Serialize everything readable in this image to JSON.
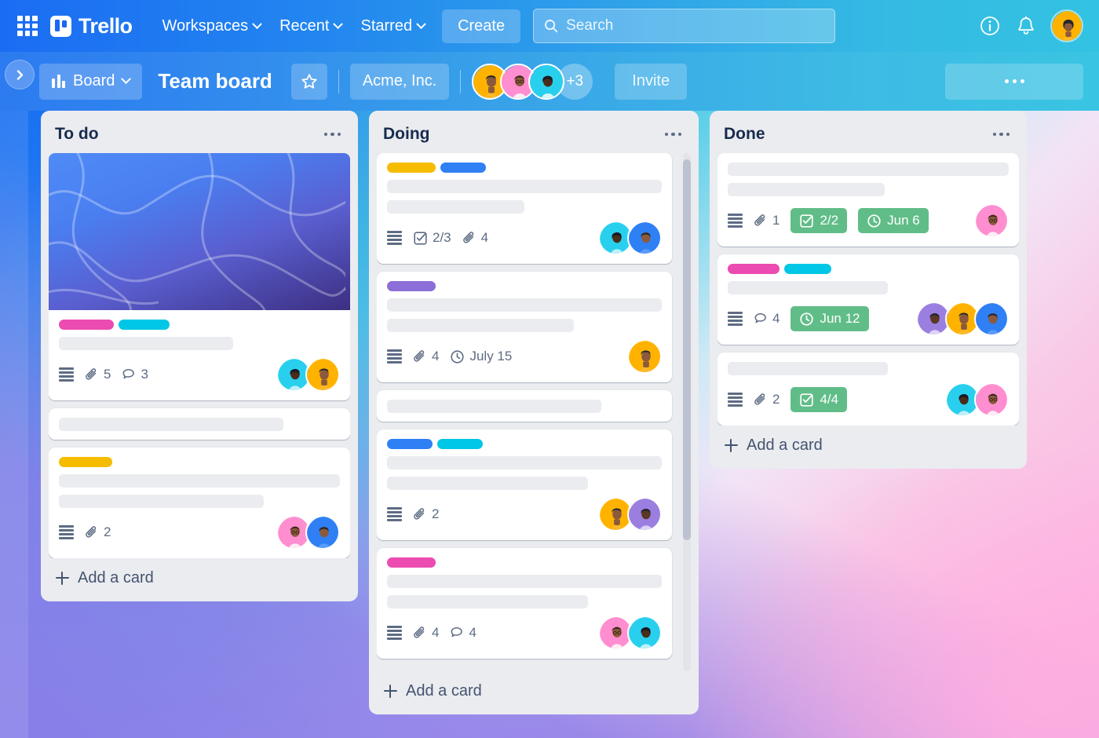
{
  "topnav": {
    "apps_icon": "grid-apps-icon",
    "brand": "Trello",
    "menus": [
      {
        "label": "Workspaces"
      },
      {
        "label": "Recent"
      },
      {
        "label": "Starred"
      }
    ],
    "create_label": "Create",
    "search_placeholder": "Search",
    "search_value": "",
    "info_icon": "info-icon",
    "notification_icon": "bell-icon",
    "profile_avatar": "user-avatar"
  },
  "boardbar": {
    "sidebar_toggle_icon": "chevron-right-icon",
    "view_label": "Board",
    "view_icon": "board-view-icon",
    "title": "Team board",
    "star_icon": "star-icon",
    "workspace": "Acme, Inc.",
    "member_overflow": "+3",
    "invite_label": "Invite",
    "more_icon": "ellipsis-icon"
  },
  "lists": [
    {
      "title": "To do",
      "add_card_label": "Add a card",
      "scrollable": false,
      "cards": [
        {
          "cover": "blue-gradient-cover",
          "labels": [
            "#ec4bb0",
            "#00c7e6"
          ],
          "skeletons": [
            85
          ],
          "badges": [
            {
              "type": "description",
              "value": ""
            },
            {
              "type": "attachment",
              "value": "5"
            },
            {
              "type": "comment",
              "value": "3"
            }
          ],
          "avatars": [
            "cyan",
            "yellow"
          ]
        },
        {
          "cover": null,
          "labels": [],
          "skeletons": [
            78
          ],
          "badges": [],
          "avatars": []
        },
        {
          "cover": null,
          "labels": [
            "#f5bc00"
          ],
          "skeletons": [
            100,
            75
          ],
          "badges": [
            {
              "type": "description",
              "value": ""
            },
            {
              "type": "attachment",
              "value": "2"
            }
          ],
          "avatars": [
            "pink",
            "blue"
          ]
        }
      ]
    },
    {
      "title": "Doing",
      "add_card_label": "Add a card",
      "scrollable": true,
      "cards": [
        {
          "cover": null,
          "labels": [
            "#f5bc00",
            "#2f80f5"
          ],
          "skeletons": [
            100,
            52
          ],
          "badges": [
            {
              "type": "description",
              "value": ""
            },
            {
              "type": "checklist",
              "value": "2/3"
            },
            {
              "type": "attachment",
              "value": "4"
            }
          ],
          "avatars": [
            "cyan",
            "blue"
          ]
        },
        {
          "cover": null,
          "labels": [
            "#8b6ed8"
          ],
          "skeletons": [
            100,
            70
          ],
          "badges": [
            {
              "type": "description",
              "value": ""
            },
            {
              "type": "attachment",
              "value": "4"
            },
            {
              "type": "due",
              "value": "July 15"
            }
          ],
          "avatars": [
            "yellow"
          ]
        },
        {
          "cover": null,
          "labels": [],
          "skeletons": [
            78
          ],
          "badges": [],
          "avatars": []
        },
        {
          "cover": null,
          "labels": [
            "#2f80f5",
            "#00c7e6"
          ],
          "skeletons": [
            100,
            70
          ],
          "badges": [
            {
              "type": "description",
              "value": ""
            },
            {
              "type": "attachment",
              "value": "2"
            }
          ],
          "avatars": [
            "yellow",
            "purple"
          ]
        },
        {
          "cover": null,
          "labels": [
            "#ec4bb0"
          ],
          "skeletons": [
            100,
            70
          ],
          "badges": [
            {
              "type": "description",
              "value": ""
            },
            {
              "type": "attachment",
              "value": "4"
            },
            {
              "type": "comment",
              "value": "4"
            }
          ],
          "avatars": [
            "pink",
            "cyan"
          ]
        }
      ]
    },
    {
      "title": "Done",
      "add_card_label": "Add a card",
      "scrollable": false,
      "cards": [
        {
          "cover": null,
          "labels": [],
          "skeletons": [
            100,
            57
          ],
          "badges": [
            {
              "type": "description",
              "value": ""
            },
            {
              "type": "attachment",
              "value": "1"
            },
            {
              "type": "checklist-done",
              "value": "2/2"
            },
            {
              "type": "due-done",
              "value": "Jun 6"
            }
          ],
          "avatars": [
            "pink"
          ]
        },
        {
          "cover": null,
          "labels": [
            "#ec4bb0",
            "#00c7e6"
          ],
          "skeletons": [
            57
          ],
          "badges": [
            {
              "type": "description",
              "value": ""
            },
            {
              "type": "comment",
              "value": "4"
            },
            {
              "type": "due-done",
              "value": "Jun 12"
            }
          ],
          "avatars": [
            "purple",
            "yellow",
            "blue"
          ]
        },
        {
          "cover": null,
          "labels": [],
          "skeletons": [
            57
          ],
          "badges": [
            {
              "type": "description",
              "value": ""
            },
            {
              "type": "attachment",
              "value": "2"
            },
            {
              "type": "checklist-done",
              "value": "4/4"
            }
          ],
          "avatars": [
            "cyan",
            "pink"
          ]
        }
      ]
    }
  ],
  "colors": {
    "green_badge": "#61bd88",
    "card_bg": "#ffffff",
    "list_bg": "#ebecf0",
    "skeleton": "#ebecf0"
  }
}
